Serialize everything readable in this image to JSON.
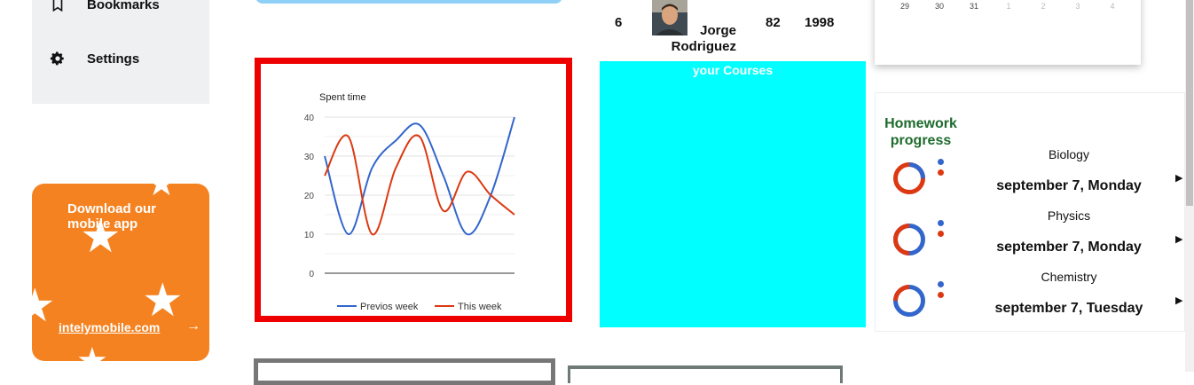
{
  "sidebar": {
    "items": [
      {
        "label": "Bookmarks",
        "icon": "bookmark-icon"
      },
      {
        "label": "Settings",
        "icon": "gear-icon"
      }
    ]
  },
  "promo": {
    "title": "Download our mobile app",
    "link": "intelymobile.com",
    "arrow": "→",
    "color": "#f58220"
  },
  "profile_row": {
    "rank": "6",
    "name": "Jorge Rodriguez",
    "score": "82",
    "year": "1998"
  },
  "courses": {
    "title": "your Courses",
    "color": "#00ffff"
  },
  "calendar": {
    "days": [
      "29",
      "30",
      "31",
      "1",
      "2",
      "3",
      "4"
    ]
  },
  "homework": {
    "title": "Homework progress",
    "items": [
      {
        "subject": "Biology",
        "date": "september 7, Monday"
      },
      {
        "subject": "Physics",
        "date": "september 7, Monday"
      },
      {
        "subject": "Chemistry",
        "date": "september 7, Tuesday"
      }
    ],
    "colors": {
      "done": "#3366cc",
      "todo": "#dc3912"
    }
  },
  "chart_data": {
    "type": "line",
    "title": "Spent time",
    "x": [
      1,
      2,
      3,
      4,
      5,
      6,
      7,
      8,
      9
    ],
    "series": [
      {
        "name": "Previos week",
        "color": "#3366cc",
        "values": [
          30,
          10,
          27,
          34,
          38,
          25,
          10,
          20,
          40
        ]
      },
      {
        "name": "This week",
        "color": "#dc3912",
        "values": [
          25,
          35,
          10,
          27,
          35,
          16,
          26,
          20,
          15
        ]
      }
    ],
    "yticks": [
      "0",
      "10",
      "20",
      "30",
      "40"
    ],
    "ylim": [
      0,
      40
    ],
    "grid": true,
    "legend": "bottom"
  }
}
